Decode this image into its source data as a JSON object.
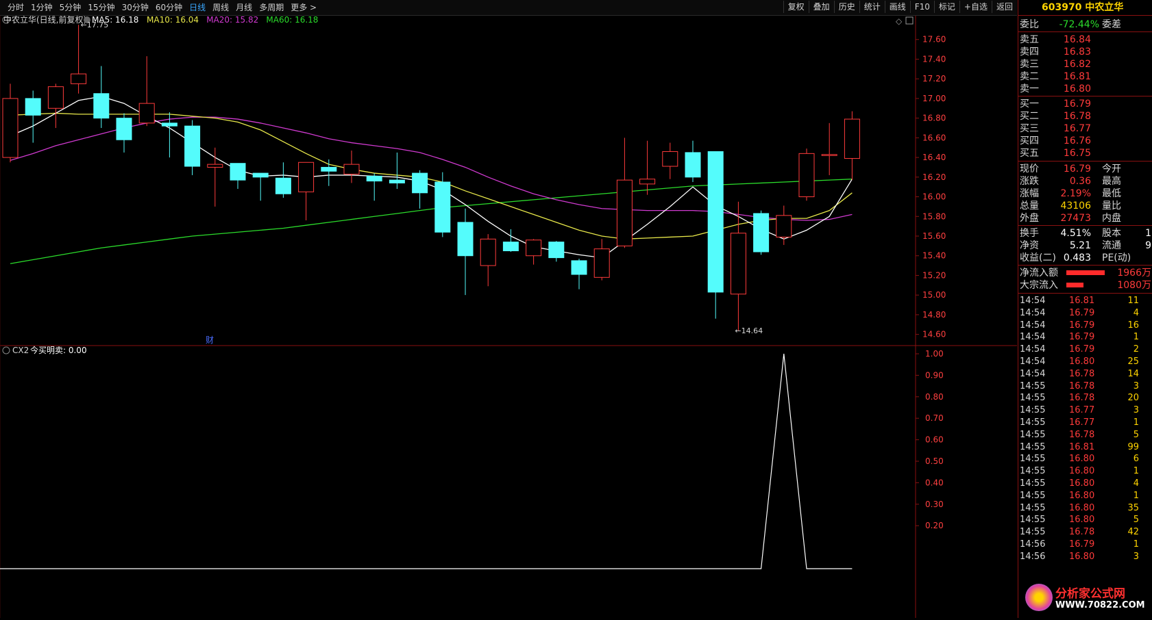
{
  "toolbar": {
    "periods": [
      "分时",
      "1分钟",
      "5分钟",
      "15分钟",
      "30分钟",
      "60分钟",
      "日线",
      "周线",
      "月线",
      "多周期",
      "更多 >"
    ],
    "active": "日线",
    "actions": [
      "复权",
      "叠加",
      "历史",
      "统计",
      "画线",
      "F10",
      "标记",
      "+自选",
      "返回"
    ]
  },
  "chart": {
    "name": "中农立华(日线,前复权)",
    "ma": [
      {
        "label": "MA5: 16.18",
        "color": "#ffffff"
      },
      {
        "label": "MA10: 16.04",
        "color": "#e8e84a"
      },
      {
        "label": "MA20: 15.82",
        "color": "#d03ad0"
      },
      {
        "label": "MA60: 16.18",
        "color": "#2bdc2b"
      }
    ],
    "high_label": "17.75",
    "low_label": "14.64",
    "finance_marker": "财",
    "price_axis": [
      "17.60",
      "17.40",
      "17.20",
      "17.00",
      "16.80",
      "16.60",
      "16.40",
      "16.20",
      "16.00",
      "15.80",
      "15.60",
      "15.40",
      "15.20",
      "15.00",
      "14.80",
      "14.60"
    ],
    "price_axis_values": [
      17.6,
      17.4,
      17.2,
      17.0,
      16.8,
      16.6,
      16.4,
      16.2,
      16.0,
      15.8,
      15.6,
      15.4,
      15.2,
      15.0,
      14.8,
      14.6
    ],
    "candles": [
      {
        "o": 16.4,
        "c": 17.0,
        "h": 17.15,
        "l": 16.35
      },
      {
        "o": 17.0,
        "c": 16.83,
        "h": 17.08,
        "l": 16.55
      },
      {
        "o": 16.9,
        "c": 17.12,
        "h": 17.15,
        "l": 16.7
      },
      {
        "o": 17.15,
        "c": 17.25,
        "h": 17.75,
        "l": 17.05
      },
      {
        "o": 17.05,
        "c": 16.8,
        "h": 17.33,
        "l": 16.7
      },
      {
        "o": 16.8,
        "c": 16.58,
        "h": 16.85,
        "l": 16.45
      },
      {
        "o": 16.75,
        "c": 16.95,
        "h": 17.43,
        "l": 16.72
      },
      {
        "o": 16.75,
        "c": 16.72,
        "h": 16.86,
        "l": 16.4
      },
      {
        "o": 16.72,
        "c": 16.31,
        "h": 16.78,
        "l": 16.22
      },
      {
        "o": 16.3,
        "c": 16.33,
        "h": 16.5,
        "l": 15.9
      },
      {
        "o": 16.34,
        "c": 16.17,
        "h": 16.34,
        "l": 16.08
      },
      {
        "o": 16.24,
        "c": 16.2,
        "h": 16.24,
        "l": 15.96
      },
      {
        "o": 16.19,
        "c": 16.03,
        "h": 16.35,
        "l": 15.99
      },
      {
        "o": 16.05,
        "c": 16.35,
        "h": 16.35,
        "l": 15.76
      },
      {
        "o": 16.3,
        "c": 16.26,
        "h": 16.38,
        "l": 16.11
      },
      {
        "o": 16.23,
        "c": 16.33,
        "h": 16.47,
        "l": 16.14
      },
      {
        "o": 16.21,
        "c": 16.16,
        "h": 16.24,
        "l": 15.96
      },
      {
        "o": 16.17,
        "c": 16.14,
        "h": 16.45,
        "l": 16.08
      },
      {
        "o": 16.24,
        "c": 16.04,
        "h": 16.27,
        "l": 15.88
      },
      {
        "o": 16.15,
        "c": 15.64,
        "h": 16.25,
        "l": 15.59
      },
      {
        "o": 15.74,
        "c": 15.4,
        "h": 15.88,
        "l": 15.0
      },
      {
        "o": 15.3,
        "c": 15.57,
        "h": 15.62,
        "l": 15.09
      },
      {
        "o": 15.54,
        "c": 15.45,
        "h": 15.67,
        "l": 15.44
      },
      {
        "o": 15.4,
        "c": 15.56,
        "h": 15.57,
        "l": 15.31
      },
      {
        "o": 15.54,
        "c": 15.38,
        "h": 15.55,
        "l": 15.34
      },
      {
        "o": 15.35,
        "c": 15.21,
        "h": 15.37,
        "l": 15.06
      },
      {
        "o": 15.18,
        "c": 15.47,
        "h": 15.57,
        "l": 15.15
      },
      {
        "o": 15.5,
        "c": 16.17,
        "h": 16.6,
        "l": 15.48
      },
      {
        "o": 16.13,
        "c": 16.18,
        "h": 16.57,
        "l": 16.02
      },
      {
        "o": 16.31,
        "c": 16.46,
        "h": 16.55,
        "l": 16.18
      },
      {
        "o": 16.45,
        "c": 16.2,
        "h": 16.57,
        "l": 16.15
      },
      {
        "o": 16.46,
        "c": 15.03,
        "h": 16.46,
        "l": 14.76
      },
      {
        "o": 15.01,
        "c": 15.63,
        "h": 15.95,
        "l": 14.64
      },
      {
        "o": 15.83,
        "c": 15.44,
        "h": 15.86,
        "l": 15.41
      },
      {
        "o": 15.59,
        "c": 15.81,
        "h": 15.91,
        "l": 15.51
      },
      {
        "o": 16.0,
        "c": 16.44,
        "h": 16.49,
        "l": 15.96
      },
      {
        "o": 16.42,
        "c": 16.43,
        "h": 16.75,
        "l": 16.22
      },
      {
        "o": 16.39,
        "c": 16.79,
        "h": 16.87,
        "l": 16.17
      }
    ],
    "ma5": [
      16.62,
      16.72,
      16.85,
      16.98,
      17.02,
      16.95,
      16.82,
      16.7,
      16.55,
      16.4,
      16.27,
      16.21,
      16.22,
      16.2,
      16.22,
      16.22,
      16.21,
      16.2,
      16.16,
      16.07,
      15.92,
      15.75,
      15.6,
      15.49,
      15.45,
      15.41,
      15.38,
      15.55,
      15.72,
      15.9,
      16.1,
      15.91,
      15.8,
      15.67,
      15.57,
      15.66,
      15.8,
      16.18
    ],
    "ma10": [
      16.83,
      16.84,
      16.85,
      16.84,
      16.84,
      16.84,
      16.84,
      16.84,
      16.82,
      16.8,
      16.76,
      16.68,
      16.56,
      16.44,
      16.33,
      16.28,
      16.24,
      16.22,
      16.2,
      16.15,
      16.06,
      15.98,
      15.9,
      15.82,
      15.74,
      15.66,
      15.6,
      15.57,
      15.58,
      15.59,
      15.6,
      15.66,
      15.72,
      15.76,
      15.78,
      15.78,
      15.86,
      16.04
    ],
    "ma20": [
      16.37,
      16.44,
      16.52,
      16.58,
      16.64,
      16.7,
      16.75,
      16.79,
      16.81,
      16.81,
      16.79,
      16.75,
      16.7,
      16.65,
      16.59,
      16.55,
      16.52,
      16.49,
      16.45,
      16.38,
      16.3,
      16.2,
      16.11,
      16.03,
      15.97,
      15.92,
      15.88,
      15.87,
      15.86,
      15.86,
      15.86,
      15.85,
      15.82,
      15.79,
      15.77,
      15.76,
      15.77,
      15.82
    ],
    "ma60": [
      15.32,
      15.36,
      15.4,
      15.44,
      15.48,
      15.51,
      15.54,
      15.57,
      15.6,
      15.62,
      15.64,
      15.66,
      15.68,
      15.71,
      15.74,
      15.77,
      15.8,
      15.83,
      15.86,
      15.89,
      15.91,
      15.93,
      15.95,
      15.97,
      15.99,
      16.01,
      16.03,
      16.05,
      16.07,
      16.09,
      16.11,
      16.12,
      16.13,
      16.14,
      16.15,
      16.16,
      16.17,
      16.18
    ]
  },
  "indicator": {
    "name": "CX2",
    "label": "今买明卖: 0.00",
    "axis": [
      "1.00",
      "0.90",
      "0.80",
      "0.70",
      "0.60",
      "0.50",
      "0.40",
      "0.30",
      "0.20"
    ],
    "axis_values": [
      1.0,
      0.9,
      0.8,
      0.7,
      0.6,
      0.5,
      0.4,
      0.3,
      0.2
    ],
    "values": [
      0,
      0,
      0,
      0,
      0,
      0,
      0,
      0,
      0,
      0,
      0,
      0,
      0,
      0,
      0,
      0,
      0,
      0,
      0,
      0,
      0,
      0,
      0,
      0,
      0,
      0,
      0,
      0,
      0,
      0,
      0,
      0,
      0,
      0,
      1,
      0,
      0,
      0
    ]
  },
  "quote": {
    "code_name": "603970 中农立华",
    "weibi": {
      "label": "委比",
      "value": "-72.44%",
      "label2": "委差"
    },
    "asks": [
      {
        "label": "卖五",
        "price": "16.84"
      },
      {
        "label": "卖四",
        "price": "16.83"
      },
      {
        "label": "卖三",
        "price": "16.82"
      },
      {
        "label": "卖二",
        "price": "16.81"
      },
      {
        "label": "卖一",
        "price": "16.80"
      }
    ],
    "bids": [
      {
        "label": "买一",
        "price": "16.79"
      },
      {
        "label": "买二",
        "price": "16.78"
      },
      {
        "label": "买三",
        "price": "16.77"
      },
      {
        "label": "买四",
        "price": "16.76"
      },
      {
        "label": "买五",
        "price": "16.75"
      }
    ],
    "stats": [
      {
        "l1": "现价",
        "v1": "16.79",
        "c1": "red",
        "l2": "今开"
      },
      {
        "l1": "涨跌",
        "v1": "0.36",
        "c1": "red",
        "l2": "最高"
      },
      {
        "l1": "涨幅",
        "v1": "2.19%",
        "c1": "red",
        "l2": "最低"
      },
      {
        "l1": "总量",
        "v1": "43106",
        "c1": "yellow",
        "l2": "量比"
      },
      {
        "l1": "外盘",
        "v1": "27473",
        "c1": "red",
        "l2": "内盘"
      }
    ],
    "stats2": [
      {
        "l1": "换手",
        "v1": "4.51%",
        "l2": "股本",
        "v2": "1"
      },
      {
        "l1": "净资",
        "v1": "5.21",
        "l2": "流通",
        "v2": "9"
      },
      {
        "l1": "收益(二)",
        "v1": "0.483",
        "l2": "PE(动)",
        "v2": ""
      }
    ],
    "flows": [
      {
        "label": "净流入额",
        "value": "1966万",
        "bar": 0.8
      },
      {
        "label": "大宗流入",
        "value": "1080万",
        "bar": 0.35
      }
    ],
    "ticks": [
      {
        "t": "14:54",
        "p": "16.81",
        "v": "11"
      },
      {
        "t": "14:54",
        "p": "16.79",
        "v": "4"
      },
      {
        "t": "14:54",
        "p": "16.79",
        "v": "16"
      },
      {
        "t": "14:54",
        "p": "16.79",
        "v": "1"
      },
      {
        "t": "14:54",
        "p": "16.79",
        "v": "2"
      },
      {
        "t": "14:54",
        "p": "16.80",
        "v": "25"
      },
      {
        "t": "14:54",
        "p": "16.78",
        "v": "14"
      },
      {
        "t": "14:55",
        "p": "16.78",
        "v": "3"
      },
      {
        "t": "14:55",
        "p": "16.78",
        "v": "20"
      },
      {
        "t": "14:55",
        "p": "16.77",
        "v": "3"
      },
      {
        "t": "14:55",
        "p": "16.77",
        "v": "1"
      },
      {
        "t": "14:55",
        "p": "16.78",
        "v": "5"
      },
      {
        "t": "14:55",
        "p": "16.81",
        "v": "99"
      },
      {
        "t": "14:55",
        "p": "16.80",
        "v": "6"
      },
      {
        "t": "14:55",
        "p": "16.80",
        "v": "1"
      },
      {
        "t": "14:55",
        "p": "16.80",
        "v": "4"
      },
      {
        "t": "14:55",
        "p": "16.80",
        "v": "1"
      },
      {
        "t": "14:55",
        "p": "16.80",
        "v": "35"
      },
      {
        "t": "14:55",
        "p": "16.80",
        "v": "5"
      },
      {
        "t": "14:55",
        "p": "16.78",
        "v": "42"
      },
      {
        "t": "14:56",
        "p": "16.79",
        "v": "1"
      },
      {
        "t": "14:56",
        "p": "16.80",
        "v": "3"
      }
    ],
    "watermark_title": "分析家公式网",
    "watermark_url": "WWW.70822.COM"
  },
  "colors": {
    "up": "#ff3b3b",
    "down": "#54fcfc",
    "ma5": "#ffffff",
    "ma10": "#e8e84a",
    "ma20": "#d03ad0",
    "ma60": "#2bdc2b",
    "frame": "#8a1111"
  }
}
